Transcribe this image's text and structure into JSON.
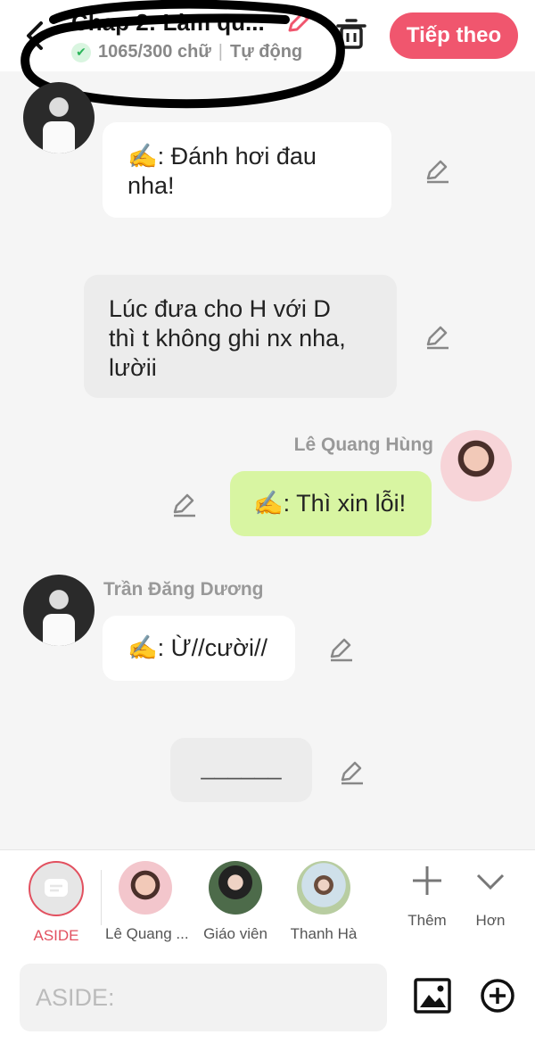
{
  "header": {
    "title": "Chap 2: Làm qu...",
    "word_count": "1065/300 chữ",
    "separator": "|",
    "mode": "Tự động",
    "next_button": "Tiếp theo",
    "accent": "#f0566e"
  },
  "messages": [
    {
      "speaker": "Trần Đăng Dương",
      "text": "✍️: Đánh hơi đau nha!",
      "line1": "✍️: Đánh hơi đau",
      "line2": "nha!"
    },
    {
      "line1": "Lúc đưa cho H với D",
      "line2": "thì t không ghi nx nha,",
      "line3": "lườii"
    },
    {
      "speaker": "Lê Quang Hùng",
      "text": "✍️: Thì xin lỗi!"
    },
    {
      "speaker": "Trần Đăng Dương",
      "text": "✍️: Ừ//cười//"
    },
    {
      "text": "______"
    }
  ],
  "toolbar": {
    "aside_label": "ASIDE",
    "characters": [
      "Lê Quang ...",
      "Giáo viên",
      "Thanh Hà"
    ],
    "more_label": "Thêm",
    "extra_label": "Hơn"
  },
  "input": {
    "placeholder": "ASIDE:"
  },
  "icons": [
    "back-icon",
    "edit-icon",
    "check-icon",
    "trash-icon",
    "pencil-icon",
    "chat-icon",
    "plus-icon",
    "chevron-down-icon",
    "image-icon",
    "add-circle-icon"
  ]
}
